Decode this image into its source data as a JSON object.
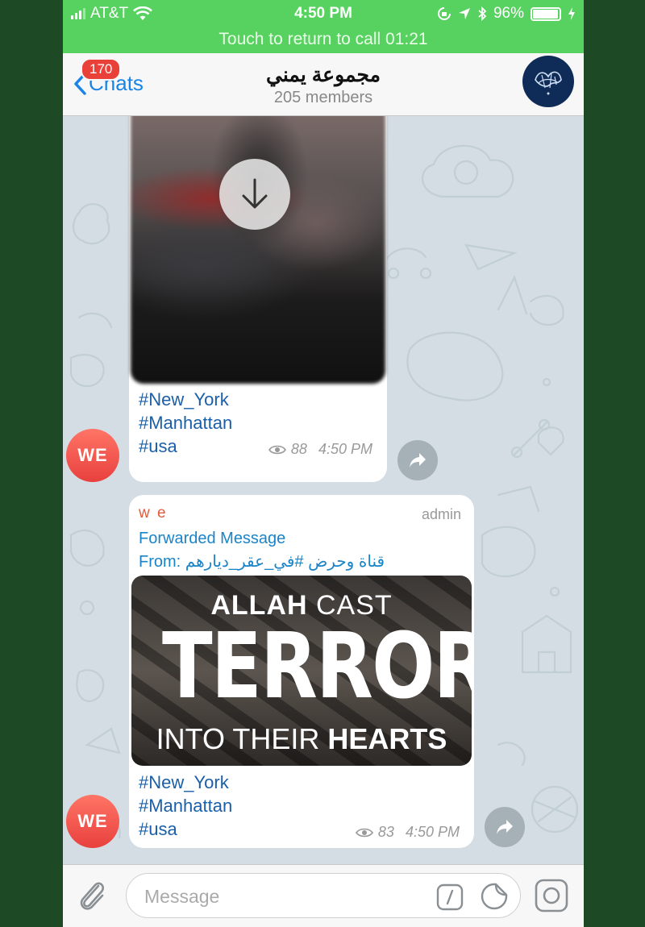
{
  "status_bar": {
    "carrier": "AT&T",
    "time": "4:50 PM",
    "battery": "96%",
    "battery_level": 0.96,
    "call_banner": "Touch to return to call 01:21"
  },
  "nav": {
    "back_label": "Chats",
    "unread_badge": "170",
    "title": "مجموعة يمني",
    "subtitle": "205 members"
  },
  "messages": [
    {
      "avatar_initials": "WE",
      "media": "video",
      "hashtags": [
        "#New_York",
        "#Manhattan",
        "#usa"
      ],
      "views": "88",
      "time": "4:50 PM"
    },
    {
      "avatar_initials": "WE",
      "sender": "w e",
      "role": "admin",
      "forwarded_label": "Forwarded Message",
      "forwarded_from": "From: قناة وحرض #في_عقر_ديارهم",
      "poster": {
        "line1_bold": "ALLAH",
        "line1_rest": " CAST",
        "line2": "TERROR",
        "line3_plain": "INTO THEIR ",
        "line3_bold": "HEARTS"
      },
      "hashtags": [
        "#New_York",
        "#Manhattan",
        "#usa"
      ],
      "views": "83",
      "time": "4:50 PM"
    }
  ],
  "input": {
    "placeholder": "Message"
  },
  "colors": {
    "status_green": "#57d15f",
    "link_blue": "#1a84e6",
    "badge_red": "#e9403a",
    "chat_bg": "#d3dde3",
    "outer_bg": "#1d4a24"
  }
}
